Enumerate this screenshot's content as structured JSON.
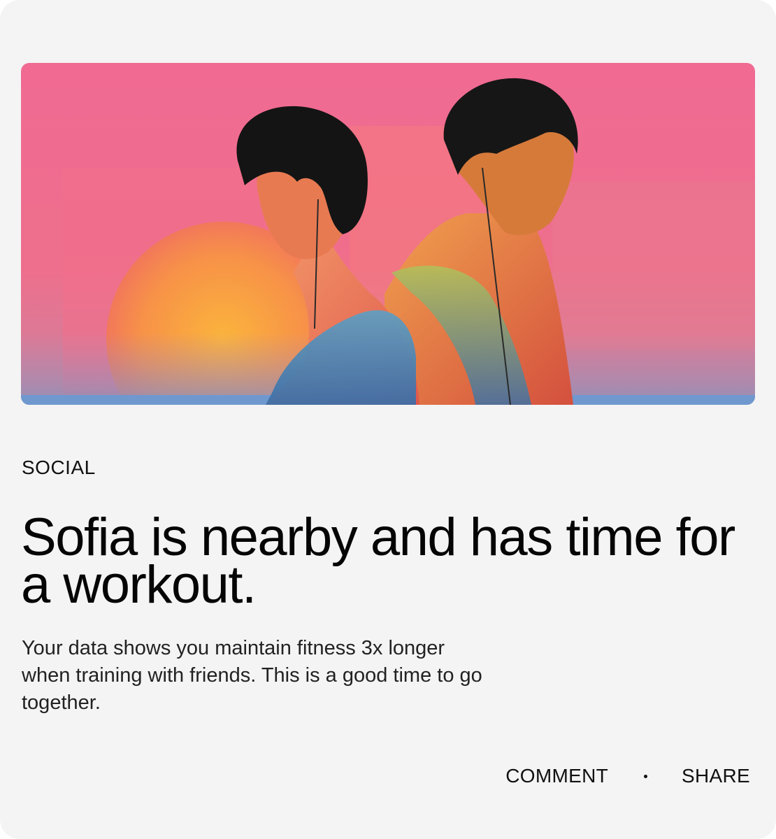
{
  "card": {
    "category": "SOCIAL",
    "title": "Sofia is nearby and has time for a workout.",
    "description": "Your data shows you maintain fitness 3x longer when training with friends. This is a good time to go together.",
    "actions": {
      "comment_label": "COMMENT",
      "share_label": "SHARE"
    },
    "colors": {
      "background": "#f4f4f4",
      "hero_pink": "#ef6a92",
      "hero_sun": "#f7a040",
      "text_primary": "#050505"
    }
  }
}
